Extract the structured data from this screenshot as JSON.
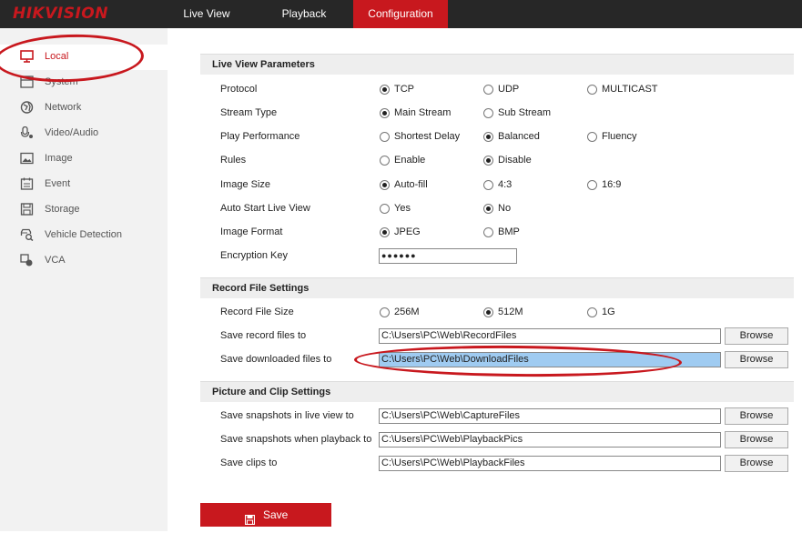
{
  "header": {
    "logo": "HIKVISION",
    "nav": [
      "Live View",
      "Playback",
      "Configuration"
    ],
    "active_nav": "Configuration"
  },
  "sidebar": {
    "items": [
      {
        "label": "Local",
        "icon": "monitor-icon",
        "active": true
      },
      {
        "label": "System",
        "icon": "system-icon"
      },
      {
        "label": "Network",
        "icon": "globe-icon"
      },
      {
        "label": "Video/Audio",
        "icon": "video-audio-icon"
      },
      {
        "label": "Image",
        "icon": "image-icon"
      },
      {
        "label": "Event",
        "icon": "calendar-icon"
      },
      {
        "label": "Storage",
        "icon": "storage-icon"
      },
      {
        "label": "Vehicle Detection",
        "icon": "vehicle-detection-icon"
      },
      {
        "label": "VCA",
        "icon": "vca-icon"
      }
    ]
  },
  "live_view": {
    "title": "Live View Parameters",
    "protocol": {
      "label": "Protocol",
      "options": [
        "TCP",
        "UDP",
        "MULTICAST"
      ],
      "selected": "TCP"
    },
    "stream_type": {
      "label": "Stream Type",
      "options": [
        "Main Stream",
        "Sub Stream"
      ],
      "selected": "Main Stream"
    },
    "play_performance": {
      "label": "Play Performance",
      "options": [
        "Shortest Delay",
        "Balanced",
        "Fluency"
      ],
      "selected": "Balanced"
    },
    "rules": {
      "label": "Rules",
      "options": [
        "Enable",
        "Disable"
      ],
      "selected": "Disable"
    },
    "image_size": {
      "label": "Image Size",
      "options": [
        "Auto-fill",
        "4:3",
        "16:9"
      ],
      "selected": "Auto-fill"
    },
    "auto_start": {
      "label": "Auto Start Live View",
      "options": [
        "Yes",
        "No"
      ],
      "selected": "No"
    },
    "image_format": {
      "label": "Image Format",
      "options": [
        "JPEG",
        "BMP"
      ],
      "selected": "JPEG"
    },
    "encryption_key": {
      "label": "Encryption Key",
      "value": "●●●●●●"
    }
  },
  "record_file": {
    "title": "Record File Settings",
    "file_size": {
      "label": "Record File Size",
      "options": [
        "256M",
        "512M",
        "1G"
      ],
      "selected": "512M"
    },
    "save_record": {
      "label": "Save record files to",
      "value": "C:\\Users\\PC\\Web\\RecordFiles"
    },
    "save_downloaded": {
      "label": "Save downloaded files to",
      "value": "C:\\Users\\PC\\Web\\DownloadFiles"
    }
  },
  "picture_clip": {
    "title": "Picture and Clip Settings",
    "snap_live": {
      "label": "Save snapshots in live view to",
      "value": "C:\\Users\\PC\\Web\\CaptureFiles"
    },
    "snap_playback": {
      "label": "Save snapshots when playback to",
      "value": "C:\\Users\\PC\\Web\\PlaybackPics"
    },
    "clips": {
      "label": "Save clips to",
      "value": "C:\\Users\\PC\\Web\\PlaybackFiles"
    }
  },
  "browse_label": "Browse",
  "save_label": "Save",
  "colors": {
    "brand": "#c8181e",
    "topbar": "#272727",
    "highlight": "#9fcbf1"
  }
}
